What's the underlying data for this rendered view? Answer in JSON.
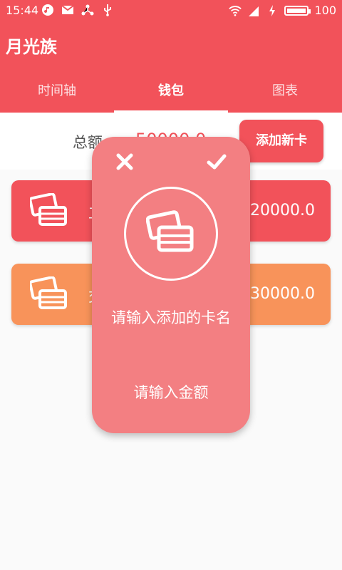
{
  "statusbar": {
    "time": "15:44",
    "battery_level": "100",
    "battery_fill_fraction": 1.0
  },
  "app": {
    "title": "月光族"
  },
  "tabs": [
    {
      "label": "时间轴"
    },
    {
      "label": "钱包"
    },
    {
      "label": "图表"
    }
  ],
  "summary": {
    "label": "总额",
    "value": "50000.0"
  },
  "buttons": {
    "add_card": "添加新卡"
  },
  "cards": [
    {
      "name": "工",
      "amount": "20000.0",
      "color": "#f2525a"
    },
    {
      "name": "交",
      "amount": "30000.0",
      "color": "#f8935a"
    }
  ],
  "dialog": {
    "prompt_card_name": "请输入添加的卡名",
    "prompt_amount": "请输入金额"
  },
  "colors": {
    "primary": "#f2525a",
    "dialog": "#f37f82",
    "card_orange": "#f8935a"
  }
}
